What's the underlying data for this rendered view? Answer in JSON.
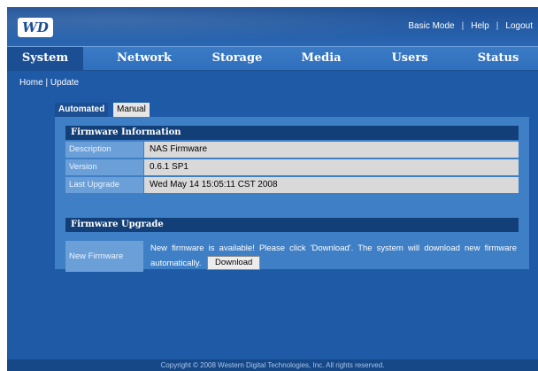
{
  "header": {
    "logo": "WD",
    "links": [
      "Basic Mode",
      "Help",
      "Logout"
    ]
  },
  "nav": {
    "tabs": [
      "System",
      "Network",
      "Storage",
      "Media",
      "Users",
      "Status"
    ],
    "active": "System"
  },
  "breadcrumb": {
    "home": "Home",
    "separator": "|",
    "current": "Update"
  },
  "subtabs": {
    "automated": "Automated",
    "manual": "Manual"
  },
  "firmware_info": {
    "title": "Firmware Information",
    "rows": [
      {
        "label": "Description",
        "value": "NAS Firmware"
      },
      {
        "label": "Version",
        "value": "0.6.1 SP1"
      },
      {
        "label": "Last Upgrade",
        "value": "Wed May 14 15:05:11 CST 2008"
      }
    ]
  },
  "firmware_upgrade": {
    "title": "Firmware Upgrade",
    "label": "New Firmware",
    "message": "New firmware is available! Please click 'Download'. The system will download new firmware automatically.",
    "button": "Download"
  },
  "footer": "Copyright © 2008 Western Digital Technologies, Inc. All rights reserved.",
  "colors": {
    "accent": "#1b4e92",
    "panel": "#3e7fc6",
    "background": "#1f5aa6"
  }
}
